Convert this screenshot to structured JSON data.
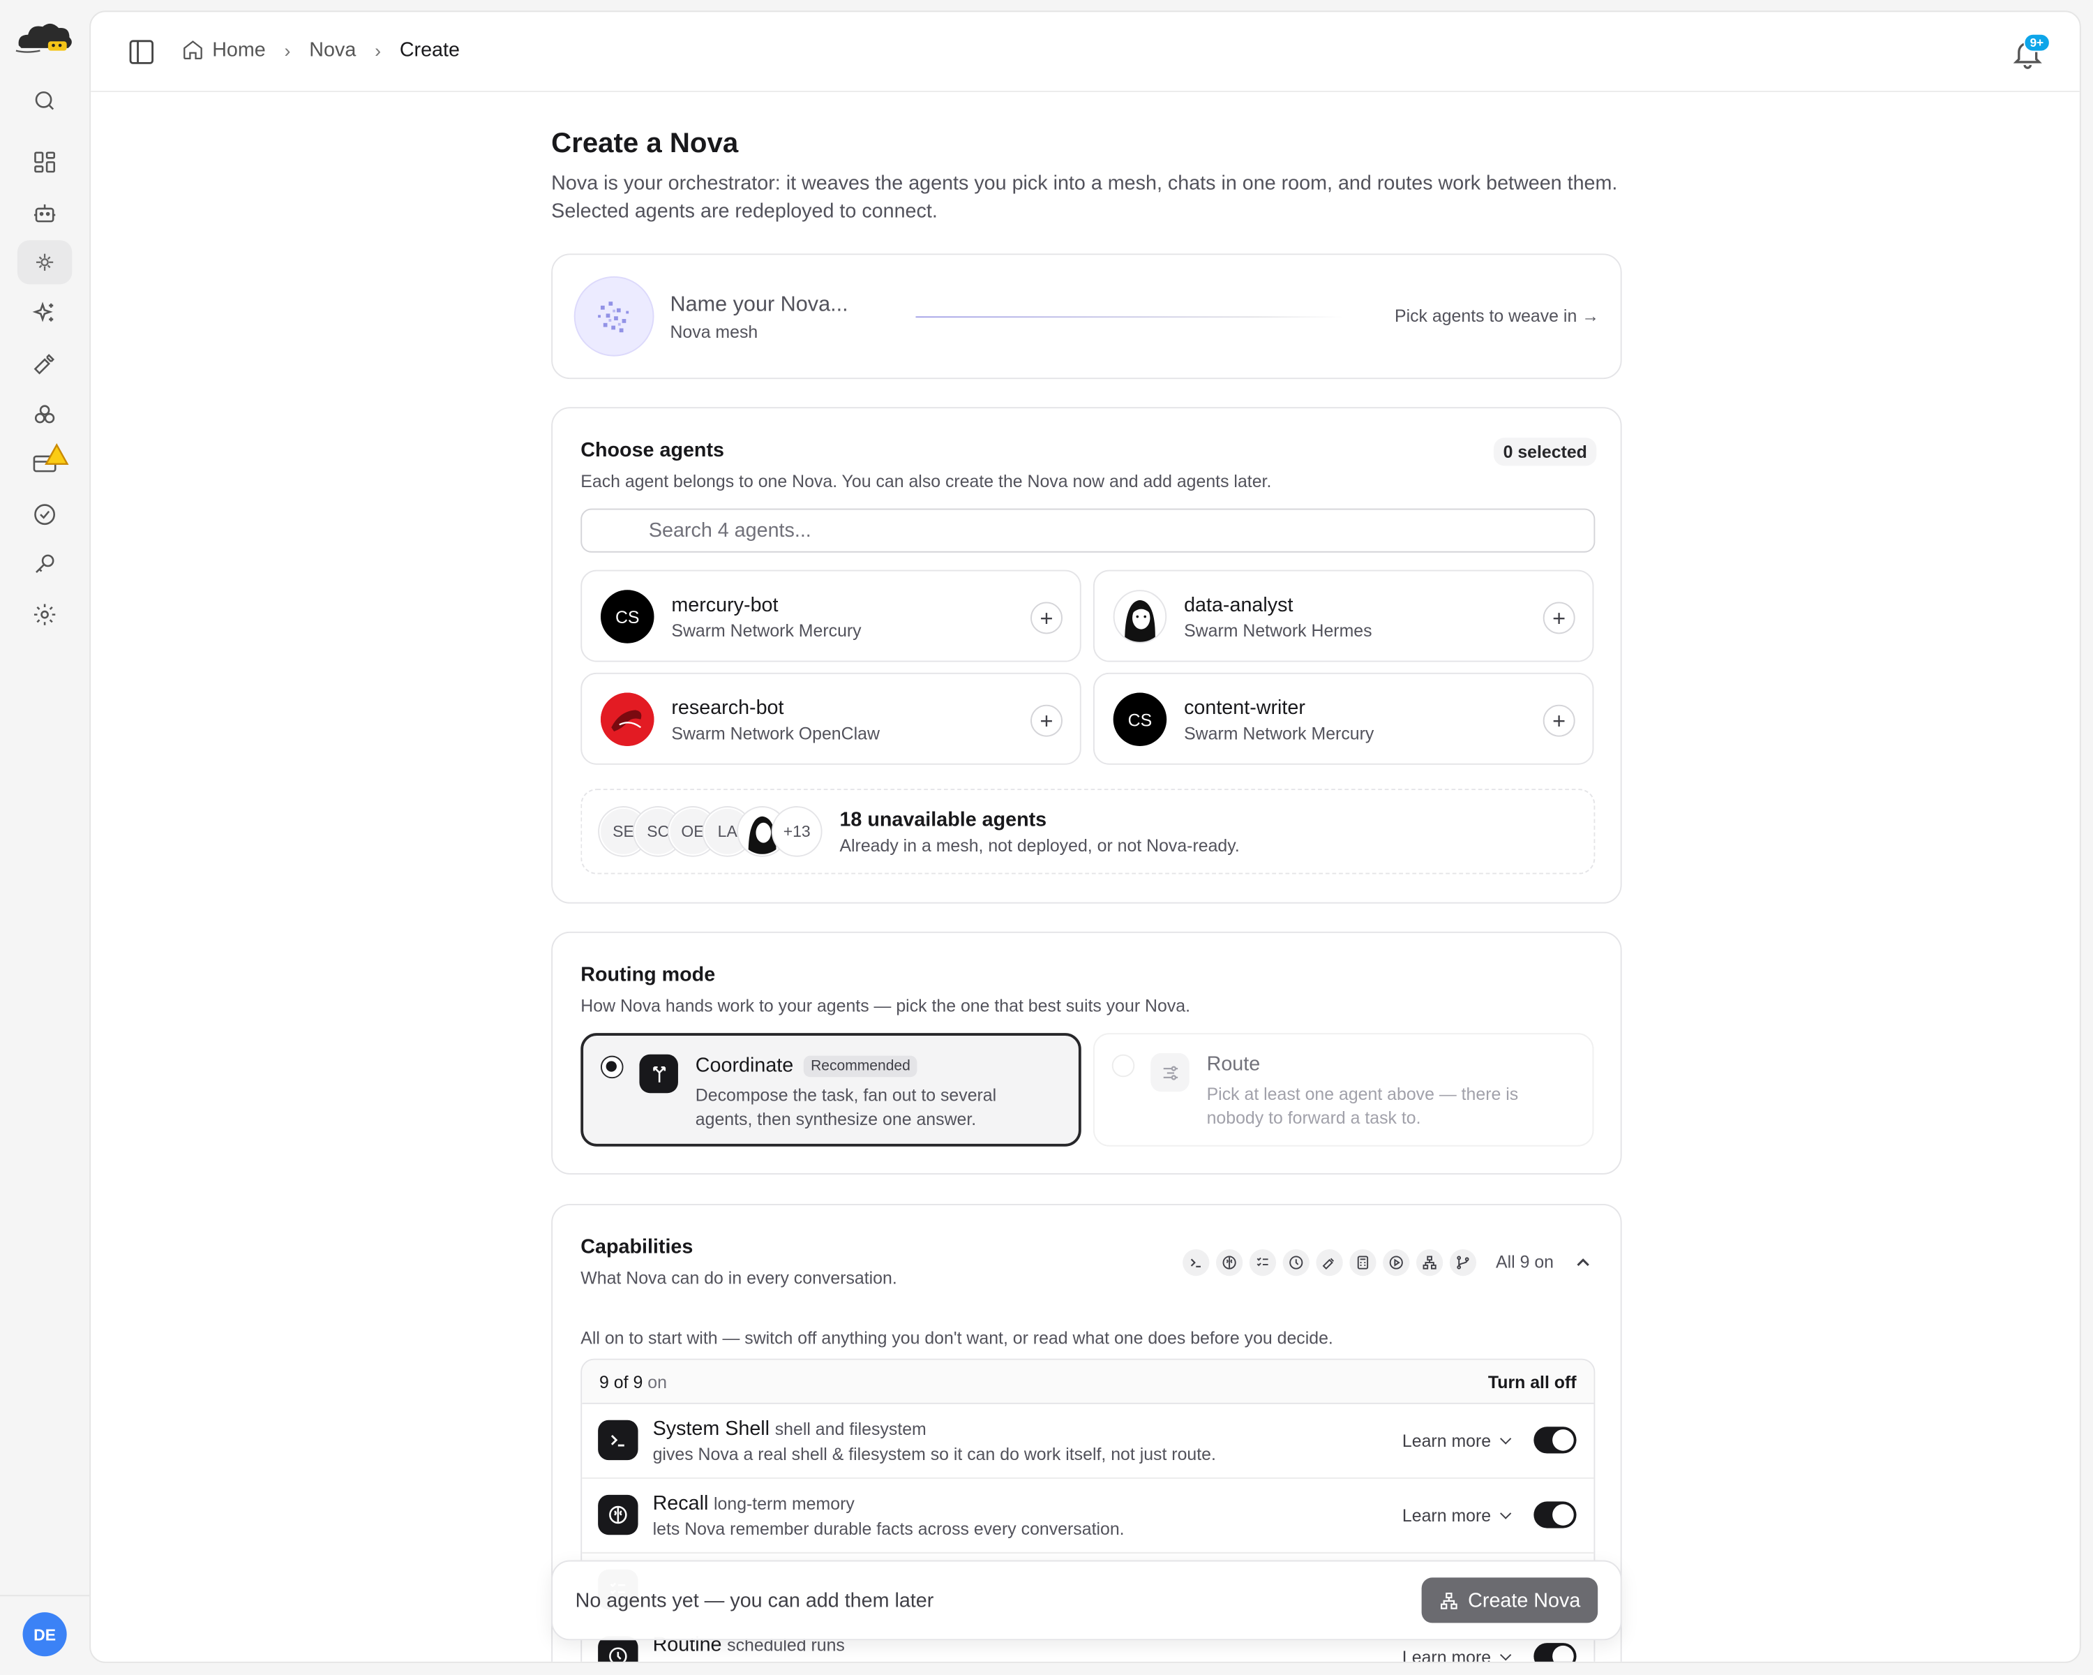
{
  "breadcrumb": {
    "home": "Home",
    "section": "Nova",
    "current": "Create"
  },
  "notifications": {
    "badge": "9+"
  },
  "user": {
    "initials": "DE"
  },
  "sidebar": {
    "icons": [
      "search-icon",
      "dashboard-icon",
      "agents-icon",
      "nova-icon",
      "sparkles-icon",
      "build-icon",
      "integrations-icon",
      "billing-icon",
      "tasks-icon",
      "keys-icon",
      "settings-icon"
    ]
  },
  "page": {
    "title": "Create a Nova",
    "description": "Nova is your orchestrator: it weaves the agents you pick into a mesh, chats in one room, and routes work between them. Selected agents are redeployed to connect."
  },
  "nova_header": {
    "name_placeholder": "Name your Nova...",
    "subtitle": "Nova mesh",
    "pick_link": "Pick agents to weave in →"
  },
  "choose_agents": {
    "title": "Choose agents",
    "selected": "0 selected",
    "subtitle": "Each agent belongs to one Nova. You can also create the Nova now and add agents later.",
    "search_placeholder": "Search 4 agents...",
    "agents": [
      {
        "name": "mercury-bot",
        "network": "Swarm Network Mercury",
        "avatar": "CS"
      },
      {
        "name": "data-analyst",
        "network": "Swarm Network Hermes",
        "avatar": ""
      },
      {
        "name": "research-bot",
        "network": "Swarm Network OpenClaw",
        "avatar": ""
      },
      {
        "name": "content-writer",
        "network": "Swarm Network Mercury",
        "avatar": "CS"
      }
    ],
    "unavailable": {
      "stack": [
        "SE",
        "SC",
        "OE",
        "LA"
      ],
      "more": "+13",
      "title": "18 unavailable agents",
      "subtitle": "Already in a mesh, not deployed, or not Nova-ready."
    }
  },
  "routing": {
    "title": "Routing mode",
    "subtitle": "How Nova hands work to your agents — pick the one that best suits your Nova.",
    "options": [
      {
        "name": "Coordinate",
        "badge": "Recommended",
        "desc": "Decompose the task, fan out to several agents, then synthesize one answer.",
        "selected": true
      },
      {
        "name": "Route",
        "desc": "Pick at least one agent above — there is nobody to forward a task to.",
        "selected": false
      }
    ]
  },
  "capabilities": {
    "title": "Capabilities",
    "subtitle": "What Nova can do in every conversation.",
    "icons": [
      "terminal-icon",
      "brain-icon",
      "checklist-icon",
      "clock-icon",
      "wrench-icon",
      "calculator-icon",
      "play-icon",
      "network-icon",
      "branch-icon"
    ],
    "summary": "All 9 on",
    "note": "All on to start with — switch off anything you don't want, or read what one does before you decide.",
    "count_main": "9 of 9",
    "count_suffix": "on",
    "turn_all_off": "Turn all off",
    "learn_more": "Learn more",
    "items": [
      {
        "name": "System Shell",
        "kind": "shell and filesystem",
        "desc": "gives Nova a real shell & filesystem so it can do work itself, not just route.",
        "on": true
      },
      {
        "name": "Recall",
        "kind": "long-term memory",
        "desc": "lets Nova remember durable facts across every conversation.",
        "on": true
      },
      {
        "name": "Routine",
        "kind": "scheduled runs",
        "desc": "",
        "on": true
      }
    ]
  },
  "footer": {
    "message": "No agents yet — you can add them later",
    "create_label": "Create Nova"
  }
}
